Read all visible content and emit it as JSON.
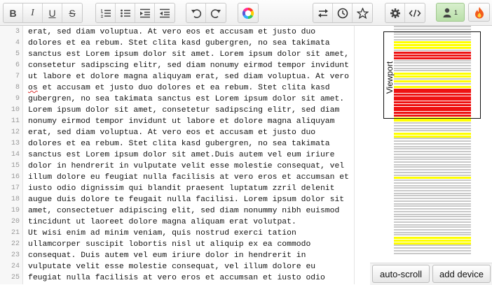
{
  "toolbar": {
    "bold": "B",
    "italic": "I",
    "underline": "U",
    "strike": "S",
    "user_count": "1"
  },
  "editor": {
    "lines": [
      {
        "num": "3",
        "text": "erat, sed diam voluptua. At vero eos et accusam et justo duo"
      },
      {
        "num": "4",
        "text": "dolores et ea rebum. Stet clita kasd gubergren, no sea takimata"
      },
      {
        "num": "5",
        "text": "sanctus est Lorem ipsum dolor sit amet. Lorem ipsum dolor sit amet,"
      },
      {
        "num": "6",
        "text": "consetetur sadipscing elitr, sed diam nonumy eirmod tempor invidunt"
      },
      {
        "num": "7",
        "text": "ut labore et dolore magna aliquyam erat, sed diam voluptua. At vero"
      },
      {
        "num": "8",
        "pre": "os",
        "text": " et accusam et justo duo dolores et ea rebum. Stet clita kasd"
      },
      {
        "num": "9",
        "text": "gubergren, no sea takimata sanctus est Lorem ipsum dolor sit amet."
      },
      {
        "num": "10",
        "text": "Lorem ipsum dolor sit amet, consetetur sadipscing elitr, sed diam"
      },
      {
        "num": "11",
        "text": "nonumy eirmod tempor invidunt ut labore et dolore magna aliquyam"
      },
      {
        "num": "12",
        "text": "erat, sed diam voluptua. At vero eos et accusam et justo duo"
      },
      {
        "num": "13",
        "text": "dolores et ea rebum. Stet clita kasd gubergren, no sea takimata"
      },
      {
        "num": "14",
        "text": "sanctus est Lorem ipsum dolor sit amet.Duis autem vel eum iriure"
      },
      {
        "num": "15",
        "text": "dolor in hendrerit in vulputate velit esse molestie consequat, vel"
      },
      {
        "num": "16",
        "text": "illum dolore eu feugiat nulla facilisis at vero eros et accumsan et"
      },
      {
        "num": "17",
        "text": "iusto odio dignissim qui blandit praesent luptatum zzril delenit"
      },
      {
        "num": "18",
        "text": "augue duis dolore te feugait nulla facilisi. Lorem ipsum dolor sit"
      },
      {
        "num": "19",
        "text": "amet, consectetuer adipiscing elit, sed diam nonummy nibh euismod"
      },
      {
        "num": "20",
        "text": "tincidunt ut laoreet dolore magna aliquam erat volutpat."
      },
      {
        "num": "21",
        "text": "Ut wisi enim ad minim veniam, quis nostrud exerci tation"
      },
      {
        "num": "22",
        "text": "ullamcorper suscipit lobortis nisl ut aliquip ex ea commodo"
      },
      {
        "num": "23",
        "text": "consequat. Duis autem vel eum iriure dolor in hendrerit in"
      },
      {
        "num": "24",
        "text": "vulputate velit esse molestie consequat, vel illum dolore eu"
      },
      {
        "num": "25",
        "text": "feugiat nulla facilisis at vero eros et accumsan et iusto odio"
      }
    ]
  },
  "minimap": {
    "viewport_label": "Viewport",
    "colors": {
      "line": "#c9c9c9",
      "highlight_yellow": "#ffff00",
      "highlight_red": "#ee1111"
    }
  },
  "footer": {
    "autoscroll_label": "auto-scroll",
    "add_device_label": "add device"
  }
}
